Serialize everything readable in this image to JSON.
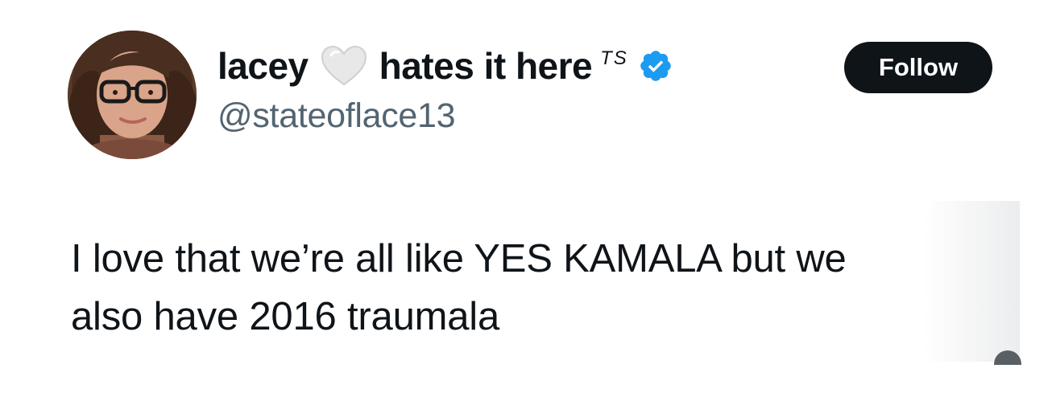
{
  "author": {
    "name": "lacey",
    "name_suffix": "hates it here",
    "tag": "TS",
    "handle": "@stateoflace13",
    "verified": true
  },
  "follow": {
    "label": "Follow"
  },
  "tweet": {
    "lines": [
      "I love that we’re all like YES KAMALA but we",
      "also have 2016 traumala"
    ]
  },
  "icons": {
    "heart": "white-heart-icon",
    "verified": "verified-badge-icon"
  },
  "colors": {
    "text": "#0f1419",
    "secondary": "#536471",
    "verified": "#1d9bf0",
    "button": "#0f1419"
  }
}
